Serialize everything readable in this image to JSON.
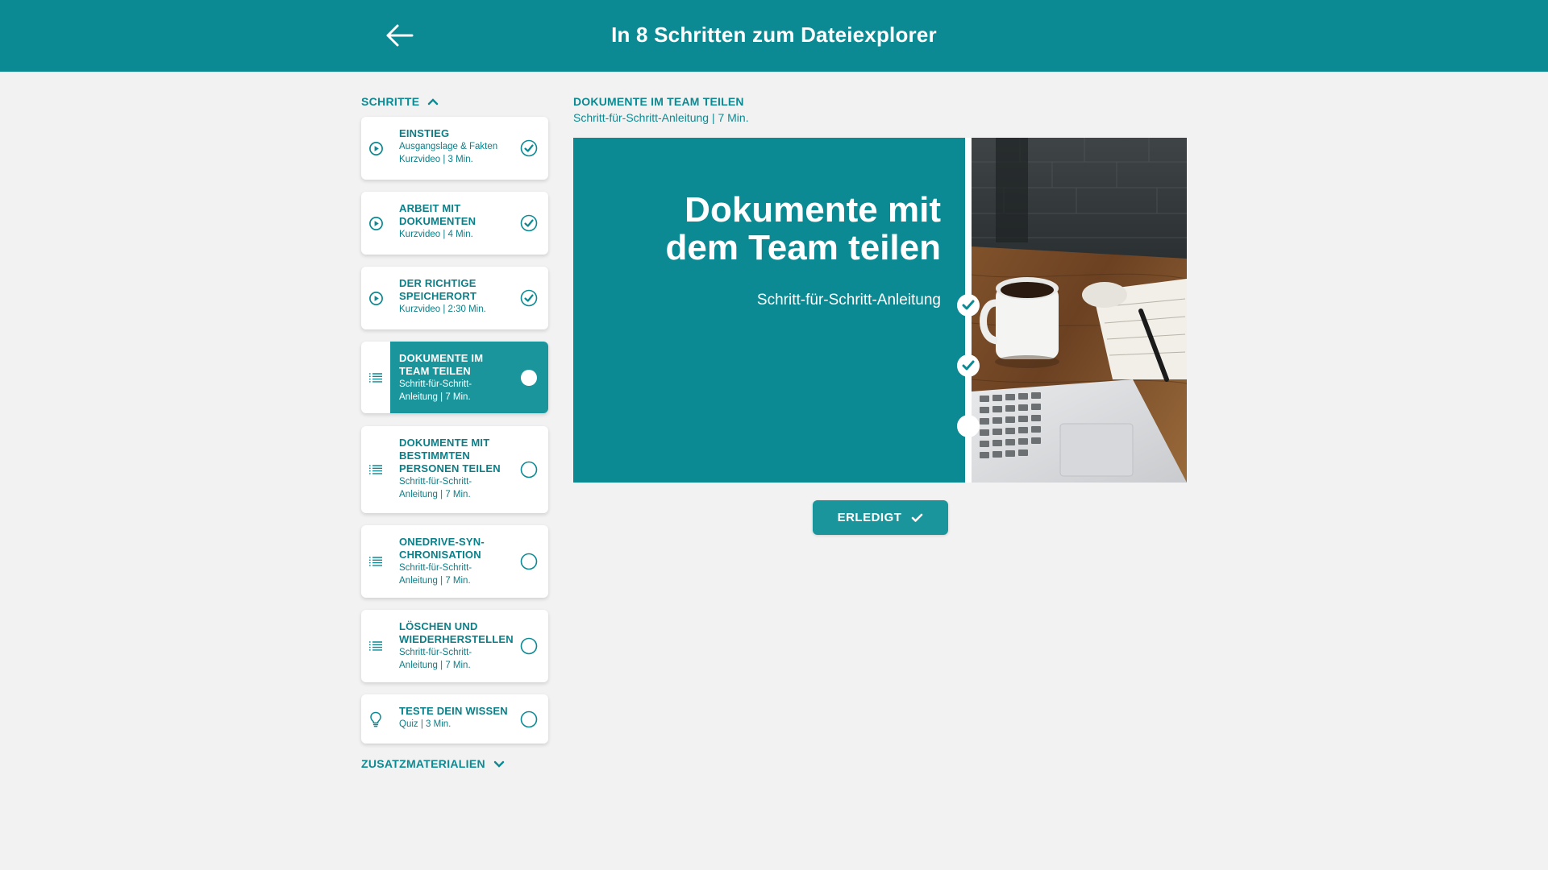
{
  "header": {
    "title": "In 8 Schritten zum Dateiexplorer",
    "back_icon": "arrow-left-icon"
  },
  "sidebar": {
    "steps_heading": "SCHRITTE",
    "extras_heading": "ZUSATZMATERIALIEN",
    "steps": [
      {
        "title": "EINSTIEG",
        "sub": [
          "Ausgangslage & Fakten",
          "Kurzvideo | 3 Min."
        ],
        "icon": "play-circle-icon",
        "status": "done"
      },
      {
        "title": "ARBEIT MIT DOKUMENTEN",
        "sub": [
          "Kurzvideo | 4 Min."
        ],
        "icon": "play-circle-icon",
        "status": "done"
      },
      {
        "title": "DER RICHTIGE SPEICHERORT",
        "sub": [
          "Kurzvideo | 2:30 Min."
        ],
        "icon": "play-circle-icon",
        "status": "done"
      },
      {
        "title": "DOKUMENTE IM TEAM TEILEN",
        "sub": [
          "Schritt-für-Schritt-Anleitung | 7 Min."
        ],
        "icon": "list-icon",
        "status": "active"
      },
      {
        "title": "DOKUMENTE MIT BESTIMMTEN PERSONEN TEILEN",
        "sub": [
          "Schritt-für-Schritt-Anleitung | 7 Min."
        ],
        "icon": "list-icon",
        "status": "open"
      },
      {
        "title": "ONEDRIVE-SYN-CHRONISATION",
        "sub": [
          "Schritt-für-Schritt-Anleitung | 7 Min."
        ],
        "icon": "list-icon",
        "status": "open"
      },
      {
        "title": "LÖSCHEN UND WIEDERHERSTELLEN",
        "sub": [
          "Schritt-für-Schritt-Anleitung | 7 Min."
        ],
        "icon": "list-icon",
        "status": "open"
      },
      {
        "title": "TESTE DEIN WISSEN",
        "sub": [
          "Quiz | 3 Min."
        ],
        "icon": "lightbulb-icon",
        "status": "open"
      }
    ]
  },
  "main": {
    "title": "DOKUMENTE IM TEAM TEILEN",
    "subtitle": "Schritt-für-Schritt-Anleitung | 7 Min.",
    "hero_title": "Dokumente mit dem Team teilen",
    "hero_sub": "Schritt-für-Schritt-Anleitung",
    "done_button": "ERLEDIGT"
  },
  "colors": {
    "brand": "#0b8a93",
    "active": "#1a959c",
    "background": "#f2f2f2"
  }
}
